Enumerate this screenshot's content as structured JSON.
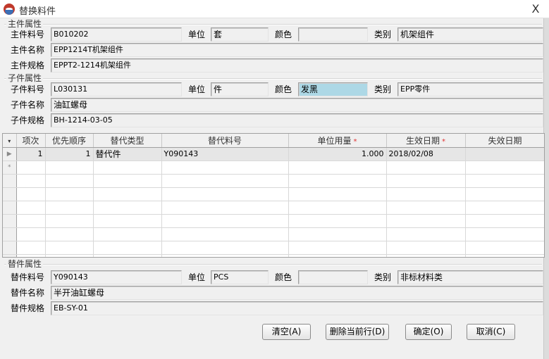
{
  "window": {
    "title": "替换料件",
    "close_glyph": "X"
  },
  "main_part": {
    "group_label": "主件属性",
    "code_label": "主件料号",
    "code": "B010202",
    "unit_label": "单位",
    "unit": "套",
    "color_label": "颜色",
    "color": "",
    "category_label": "类别",
    "category": "机架组件",
    "name_label": "主件名称",
    "name": "EPP1214T机架组件",
    "spec_label": "主件规格",
    "spec": "EPPT2-1214机架组件"
  },
  "sub_part": {
    "group_label": "子件属性",
    "code_label": "子件料号",
    "code": "L030131",
    "unit_label": "单位",
    "unit": "件",
    "color_label": "颜色",
    "color": "发黑",
    "category_label": "类别",
    "category": "EPP零件",
    "name_label": "子件名称",
    "name": "油缸螺母",
    "spec_label": "子件规格",
    "spec": "BH-1214-03-05"
  },
  "grid": {
    "corner_glyph": "▾",
    "columns": [
      "项次",
      "优先顺序",
      "替代类型",
      "替代料号",
      "单位用量",
      "生效日期",
      "失效日期"
    ],
    "required_mark": "*",
    "rows": [
      {
        "marker": "▶",
        "item": "1",
        "priority": "1",
        "type": "替代件",
        "part": "Y090143",
        "qty": "1.000",
        "start": "2018/02/08",
        "end": ""
      }
    ],
    "new_row_marker": "*"
  },
  "replacement_part": {
    "group_label": "替件属性",
    "code_label": "替件料号",
    "code": "Y090143",
    "unit_label": "单位",
    "unit": "PCS",
    "color_label": "颜色",
    "color": "",
    "category_label": "类别",
    "category": "非标材料类",
    "name_label": "替件名称",
    "name": "半开油缸螺母",
    "spec_label": "替件规格",
    "spec": "EB-SY-01"
  },
  "buttons": {
    "clear": "清空(A)",
    "delete_row": "删除当前行(D)",
    "ok": "确定(O)",
    "cancel": "取消(C)"
  }
}
